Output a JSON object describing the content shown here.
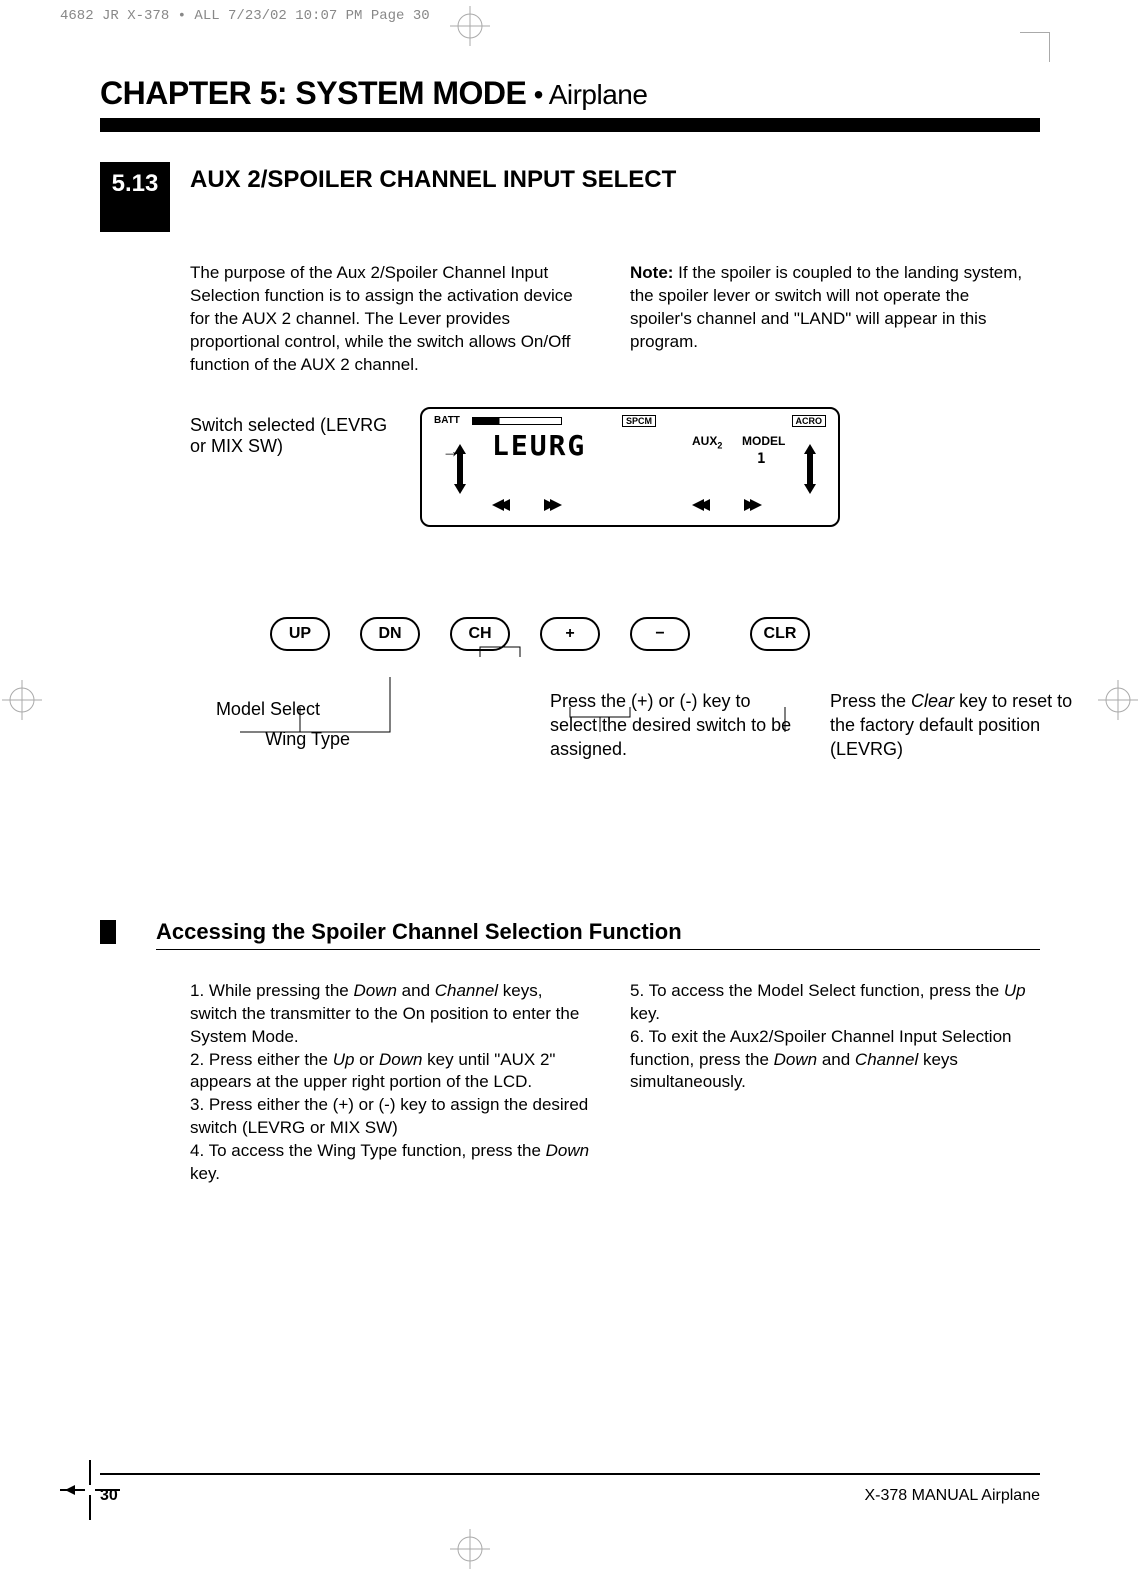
{
  "print_header": "4682 JR X-378 • ALL  7/23/02  10:07 PM  Page 30",
  "chapter_title": "CHAPTER 5: SYSTEM MODE",
  "chapter_sub": " • Airplane",
  "section_num": "5.13",
  "section_title": "AUX 2/SPOILER CHANNEL INPUT SELECT",
  "col_left": "The purpose of the Aux 2/Spoiler Channel Input Selection function is to assign the activation device for the AUX 2 channel. The Lever provides proportional control, while the switch allows On/Off function of the AUX 2 channel.",
  "note_bold": "Note:",
  "note_text": " If the spoiler is coupled to the landing system, the spoiler lever or switch will not operate the spoiler's channel and \"LAND\" will appear in this program.",
  "lcd_label": "Switch selected (LEVRG or MIX SW)",
  "lcd": {
    "batt": "BATT",
    "spcm": "SPCM",
    "main": "LEURG",
    "aux": "AUX",
    "aux_sub": "2",
    "model": "MODEL",
    "model_num": "1",
    "acro": "ACRO"
  },
  "buttons": {
    "up": "UP",
    "dn": "DN",
    "ch": "CH",
    "plus": "+",
    "minus": "−",
    "clr": "CLR"
  },
  "model_select": "Model Select",
  "wing_type": "Wing Type",
  "plus_minus_text_1": "Press the (+) or (-) key to select the desired switch to be assigned.",
  "clr_text_pre": "Press the ",
  "clr_text_italic": "Clear",
  "clr_text_post": " key to reset to the factory default position (LEVRG)",
  "access_title": "Accessing the Spoiler Channel Selection Function",
  "steps_left": [
    {
      "pre": "1. While pressing the ",
      "i1": "Down",
      "mid": " and ",
      "i2": "Channel",
      "post": " keys, switch the transmitter to the On position to enter the System Mode."
    },
    {
      "pre": "2. Press either the ",
      "i1": "Up",
      "mid": " or ",
      "i2": "Down",
      "post": " key until \"AUX 2\" appears at the upper right portion of the LCD."
    },
    {
      "pre": "3. Press either the (+) or (-) key to assign the desired switch (LEVRG or MIX SW)",
      "i1": "",
      "mid": "",
      "i2": "",
      "post": ""
    },
    {
      "pre": "4. To access the Wing Type function, press the ",
      "i1": "Down",
      "mid": "",
      "i2": "",
      "post": " key."
    }
  ],
  "steps_right": [
    {
      "pre": "5. To access the Model Select function, press the ",
      "i1": "Up",
      "mid": "",
      "i2": "",
      "post": " key."
    },
    {
      "pre": "6. To exit the Aux2/Spoiler Channel Input Selection function, press the ",
      "i1": "Down",
      "mid": " and ",
      "i2": "Channel",
      "post": " keys simultaneously."
    }
  ],
  "page_num": "30",
  "footer_right": "X-378  MANUAL Airplane"
}
